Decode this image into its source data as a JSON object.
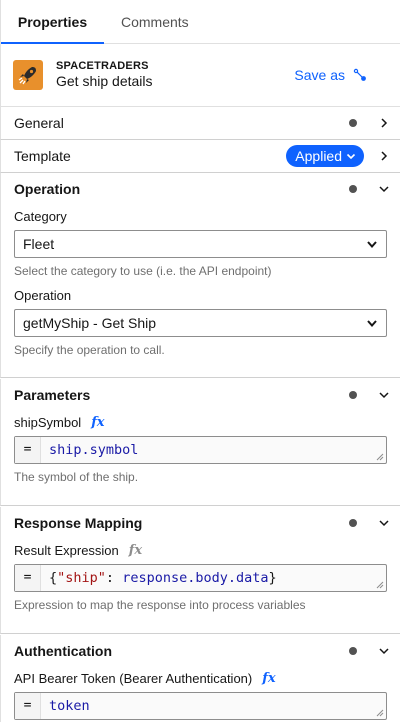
{
  "tabs": {
    "properties": "Properties",
    "comments": "Comments"
  },
  "header": {
    "brand": "SPACETRADERS",
    "title": "Get ship details",
    "save_as": "Save as"
  },
  "groups": {
    "general": "General",
    "template": {
      "label": "Template",
      "badge": "Applied"
    },
    "operation": {
      "title": "Operation",
      "category_label": "Category",
      "category_value": "Fleet",
      "category_hint": "Select the category to use (i.e. the API endpoint)",
      "operation_label": "Operation",
      "operation_value": "getMyShip - Get Ship",
      "operation_hint": "Specify the operation to call."
    },
    "parameters": {
      "title": "Parameters",
      "field_label": "shipSymbol",
      "eq": "=",
      "value": "ship.symbol",
      "hint": "The symbol of the ship."
    },
    "response": {
      "title": "Response Mapping",
      "field_label": "Result Expression",
      "eq": "=",
      "value_open": "{",
      "value_key": "\"ship\"",
      "value_colon": ": ",
      "value_expr": "response.body.data",
      "value_close": "}",
      "hint": "Expression to map the response into process variables"
    },
    "auth": {
      "title": "Authentication",
      "field_label": "API Bearer Token (Bearer Authentication)",
      "eq": "=",
      "value": "token"
    }
  },
  "icons": {
    "fx": "fx",
    "logo": "rocket-icon"
  },
  "colors": {
    "accent": "#0f62fe",
    "logo_bg": "#e8902c"
  }
}
